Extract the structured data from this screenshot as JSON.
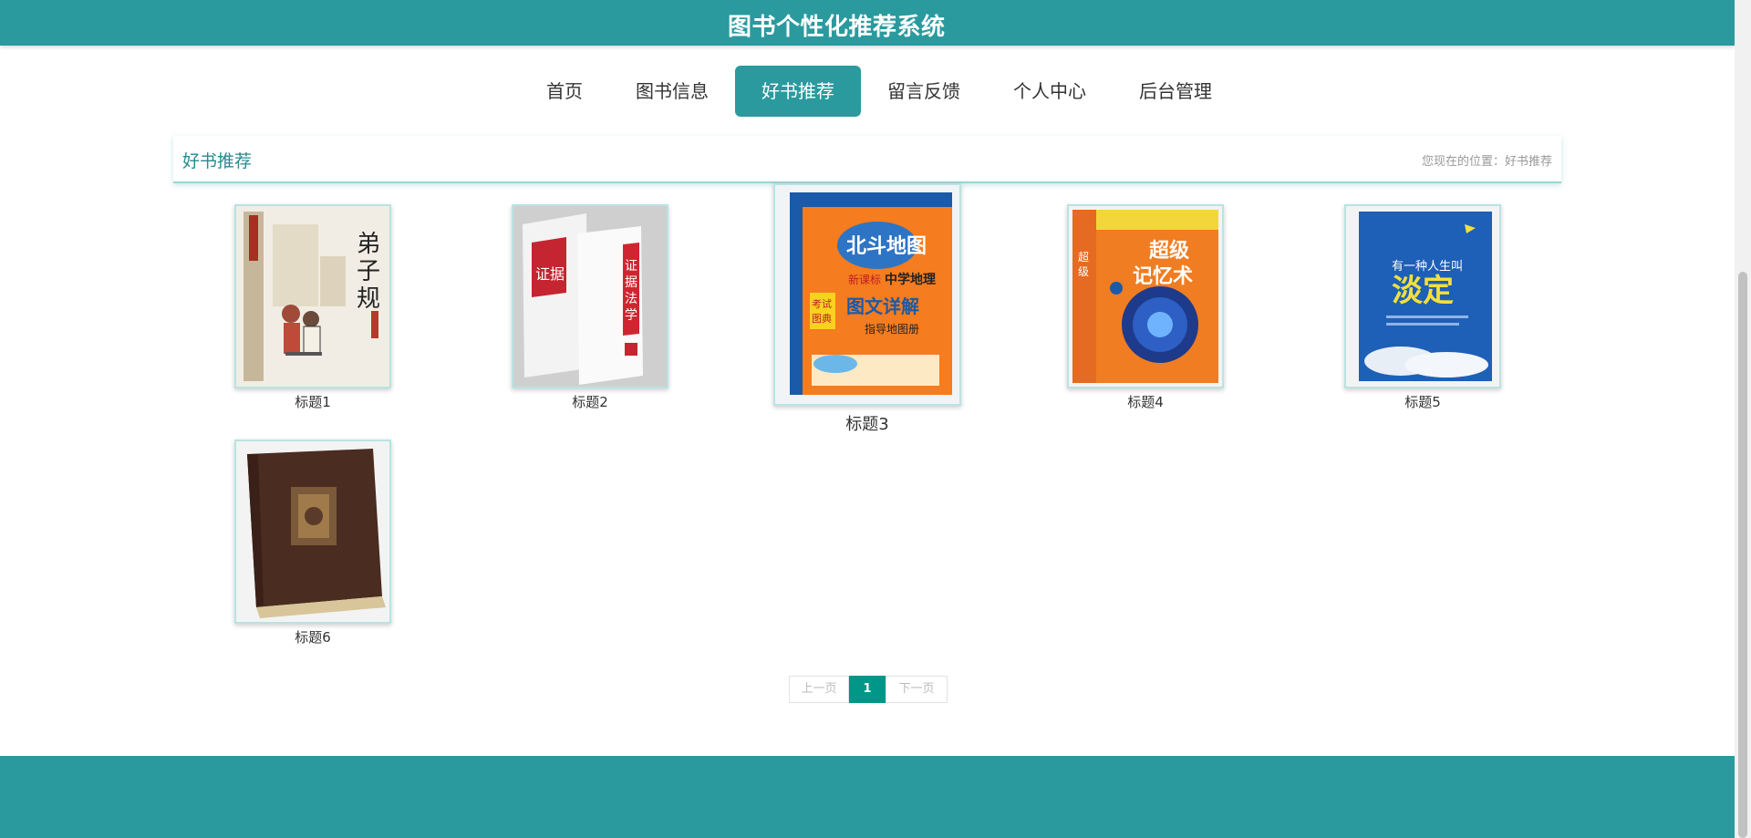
{
  "header": {
    "site_title": "图书个性化推荐系统"
  },
  "nav": {
    "items": [
      {
        "label": "首页",
        "active": false
      },
      {
        "label": "图书信息",
        "active": false
      },
      {
        "label": "好书推荐",
        "active": true
      },
      {
        "label": "留言反馈",
        "active": false
      },
      {
        "label": "个人中心",
        "active": false
      },
      {
        "label": "后台管理",
        "active": false
      }
    ]
  },
  "section": {
    "title": "好书推荐",
    "breadcrumb_prefix": "您现在的位置：",
    "breadcrumb_current": "好书推荐"
  },
  "books": [
    {
      "title": "标题1",
      "cover_icon": "dizigui-book-cover"
    },
    {
      "title": "标题2",
      "cover_icon": "evidence-law-book-cover"
    },
    {
      "title": "标题3",
      "cover_icon": "geography-atlas-book-cover"
    },
    {
      "title": "标题4",
      "cover_icon": "super-memory-book-cover"
    },
    {
      "title": "标题5",
      "cover_icon": "calm-life-book-cover"
    },
    {
      "title": "标题6",
      "cover_icon": "leather-old-book-cover"
    }
  ],
  "pager": {
    "prev_label": "上一页",
    "current_page": "1",
    "next_label": "下一页"
  },
  "colors": {
    "brand": "#2a9a9e",
    "pager_active": "#009688"
  }
}
